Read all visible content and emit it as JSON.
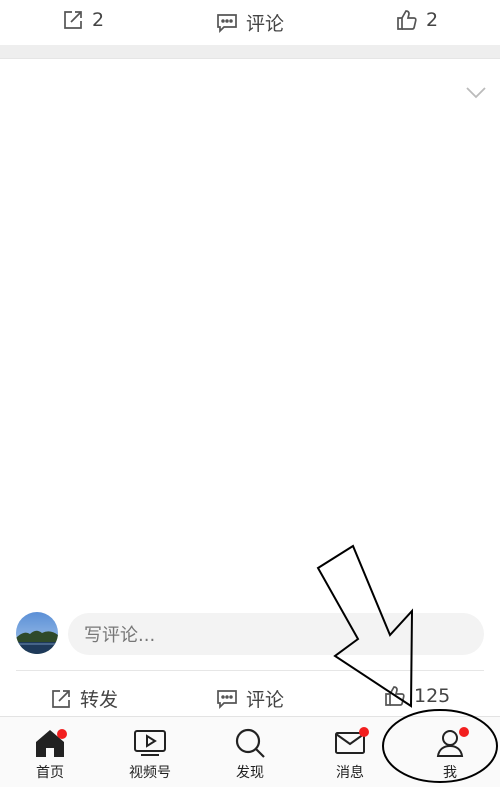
{
  "top_actions": {
    "share_count": "2",
    "comment_label": "评论",
    "like_count": "2"
  },
  "comment_box": {
    "placeholder": "写评论..."
  },
  "bottom_actions": {
    "share_label": "转发",
    "comment_label": "评论",
    "like_count": "125"
  },
  "tabbar": {
    "tabs": [
      {
        "label": "首页",
        "icon": "home-icon",
        "badge": true
      },
      {
        "label": "视频号",
        "icon": "video-icon",
        "badge": false
      },
      {
        "label": "发现",
        "icon": "search-icon",
        "badge": false
      },
      {
        "label": "消息",
        "icon": "mail-icon",
        "badge": true
      },
      {
        "label": "我",
        "icon": "user-icon",
        "badge": true
      }
    ]
  },
  "colors": {
    "badge": "#f21f1f",
    "icon": "#444444",
    "input_bg": "#f3f3f3"
  }
}
